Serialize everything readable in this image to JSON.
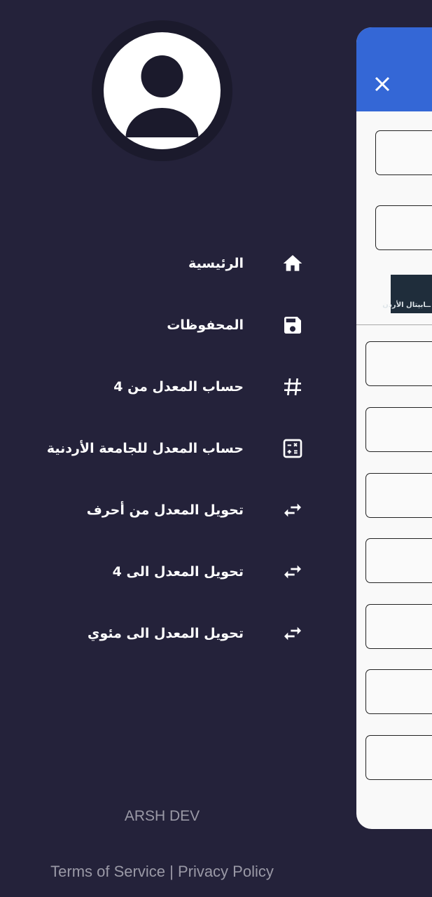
{
  "drawer": {
    "menu": [
      {
        "label": "الرئيسية",
        "icon": "home-icon"
      },
      {
        "label": "المحفوظات",
        "icon": "save-icon"
      },
      {
        "label": "حساب المعدل من 4",
        "icon": "hash-icon"
      },
      {
        "label": "حساب المعدل للجامعة الأردنية",
        "icon": "calculator-icon"
      },
      {
        "label": "تحويل المعدل من أحرف",
        "icon": "swap-icon"
      },
      {
        "label": "تحويل المعدل الى 4",
        "icon": "swap-icon"
      },
      {
        "label": "تحويل المعدل الى مئوي",
        "icon": "swap-icon"
      }
    ],
    "developer": "ARSH DEV",
    "terms": "Terms of Service",
    "separator": "|",
    "privacy": "Privacy Policy"
  },
  "background_page": {
    "header_color": "#3467d6",
    "logo_text": "كابيتال الأردن"
  },
  "colors": {
    "drawer_bg": "#24223a",
    "accent": "#3467d6"
  }
}
